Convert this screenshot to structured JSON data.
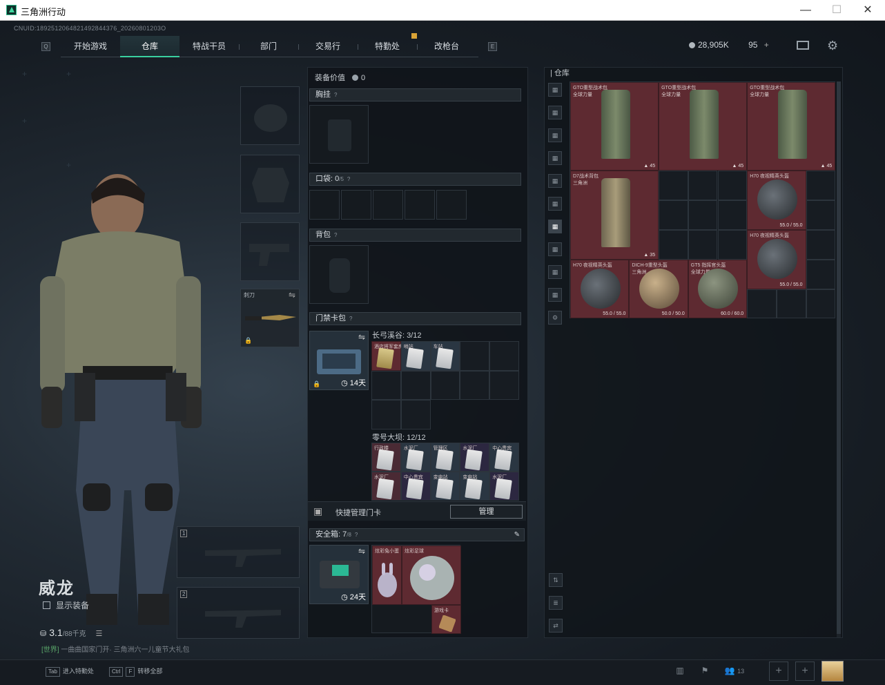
{
  "window": {
    "title": "三角洲行动",
    "controls": [
      "—",
      "☐",
      "✕"
    ]
  },
  "cnuid": "CNUID:1892512064821492844376_20260801203O",
  "nav": {
    "tabs": [
      "开始游戏",
      "仓库",
      "特战干员",
      "部门",
      "交易行",
      "特勤处",
      "改枪台"
    ],
    "active_index": 1,
    "left_key": "Q",
    "right_key": "E"
  },
  "currency": {
    "coins": "28,905K",
    "bonds": "95",
    "plus": "+"
  },
  "character": {
    "name": "威龙",
    "show_equipment": "显示装备",
    "weight": "3.1",
    "weight_max": "/88千克",
    "chat_channel": "[世界]",
    "chat_text": " 一曲曲国家门开· 三角洲六一儿童节大礼包"
  },
  "gear_slots": {
    "weapon_slot_label": "刺刀",
    "primary_1": "1",
    "primary_2": "2"
  },
  "bottom_hints": [
    {
      "key": "Tab",
      "label": "进入特勤处"
    },
    {
      "key": "Ctrl",
      "key2": "F",
      "label": "转移全部"
    }
  ],
  "bottom_right": {
    "friends_count": "13"
  },
  "equipment_panel": {
    "value_label": "装备价值",
    "value": "0",
    "chest_rig": "胸挂",
    "pockets": "口袋:",
    "pockets_count": "0",
    "pockets_max": "/5",
    "backpack": "背包",
    "keycard_case": "门禁卡包",
    "keycard_days": "14天",
    "map1_name": "长弓溪谷:",
    "map1_count": "3/12",
    "map1_cards": [
      "酒店将军套房",
      "哨站",
      "车站"
    ],
    "map2_name": "零号大坝:",
    "map2_count": "12/12",
    "map2_cards": [
      "行政楼",
      "水泥厂",
      "管理区",
      "水泥厂",
      "中心贵宾",
      "水泥厂",
      "中心贵宾",
      "变电站",
      "变电站",
      "水泥厂"
    ],
    "quick_manage": "快捷管理门卡",
    "manage_btn": "管理",
    "safe_box": "安全箱:",
    "safe_count": "7",
    "safe_max": "/8",
    "safe_days": "24天",
    "safe_items": [
      {
        "label": "炫彩兔小蛋"
      },
      {
        "label": "炫彩足球"
      },
      {
        "label": "游戏卡"
      }
    ]
  },
  "warehouse": {
    "title": "仓库",
    "items": [
      {
        "name": "GTO重型战术包",
        "sub": "全球力量",
        "val": "45"
      },
      {
        "name": "GTO重型战术包",
        "sub": "全球力量",
        "val": "45"
      },
      {
        "name": "GTO重型战术包",
        "sub": "全球力量",
        "val": "45"
      },
      {
        "name": "D7战术背包",
        "sub": "三角洲",
        "val": "35"
      },
      {
        "name": "H70 夜视精英头盔",
        "sub": "",
        "val": "55.0 / 55.0"
      },
      {
        "name": "H70 夜视精英头盔",
        "sub": "",
        "val": "55.0 / 55.0"
      },
      {
        "name": "H70 夜视精英头盔",
        "sub": "",
        "val": "55.0 / 55.0"
      },
      {
        "name": "DICH-9重型头盔",
        "sub": "三角洲",
        "val": "50.0 / 50.0"
      },
      {
        "name": "GT5 指挥官头盔",
        "sub": "全球力量",
        "val": "60.0 / 60.0"
      }
    ]
  },
  "colors": {
    "accent": "#3ad1a0",
    "item_red": "#5e2a31",
    "panel": "#101519"
  }
}
